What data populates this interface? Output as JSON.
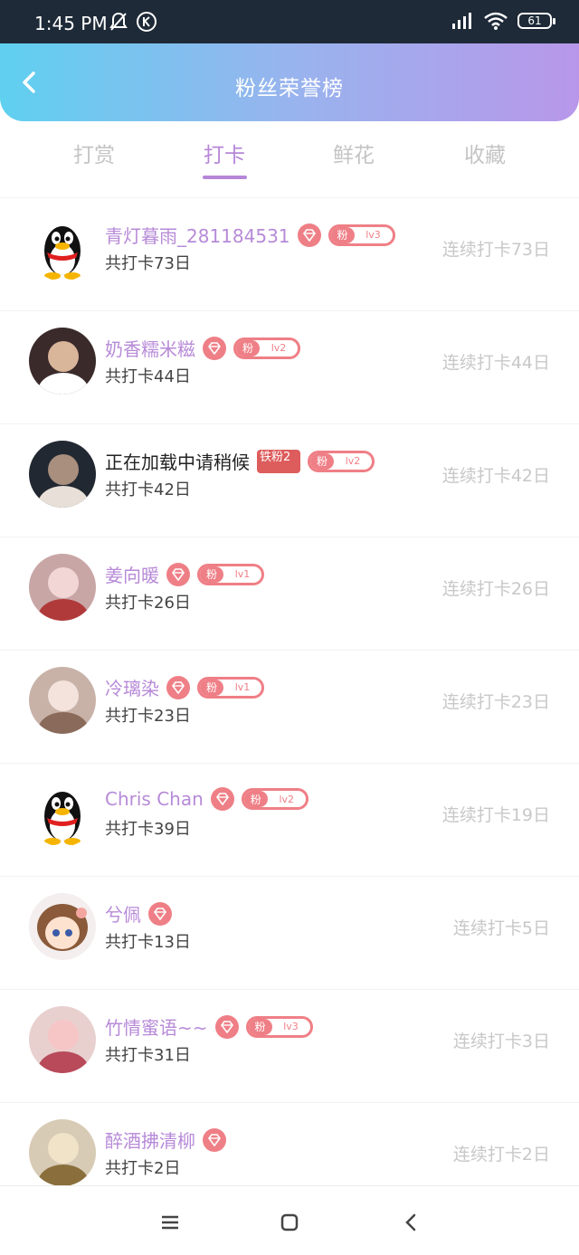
{
  "status": {
    "time": "1:45 PM",
    "battery": "61"
  },
  "header": {
    "title": "粉丝荣誉榜"
  },
  "tabs": [
    "打赏",
    "打卡",
    "鲜花",
    "收藏"
  ],
  "active_tab": 1,
  "rows": [
    {
      "name": "青灯暮雨_281184531",
      "total": "共打卡73日",
      "streak": "连续打卡73日",
      "level": "lv3",
      "fan": "粉",
      "avatar": "penguin-icon"
    },
    {
      "name": "奶香糯米糍",
      "total": "共打卡44日",
      "streak": "连续打卡44日",
      "level": "lv2",
      "fan": "粉",
      "avatar": "user-photo"
    },
    {
      "name": "正在加载中请稍候",
      "total": "共打卡42日",
      "streak": "连续打卡42日",
      "level": "lv2",
      "fan": "粉",
      "iron": "铁粉2",
      "avatar": "user-photo"
    },
    {
      "name": "姜向暖",
      "total": "共打卡26日",
      "streak": "连续打卡26日",
      "level": "lv1",
      "fan": "粉",
      "avatar": "user-photo"
    },
    {
      "name": "冷璃染",
      "total": "共打卡23日",
      "streak": "连续打卡23日",
      "level": "lv1",
      "fan": "粉",
      "avatar": "user-photo"
    },
    {
      "name": "Chris Chan",
      "total": "共打卡39日",
      "streak": "连续打卡19日",
      "level": "lv2",
      "fan": "粉",
      "avatar": "penguin-icon"
    },
    {
      "name": "兮佩",
      "total": "共打卡13日",
      "streak": "连续打卡5日",
      "avatar": "anime-avatar"
    },
    {
      "name": "竹情蜜语~~",
      "total": "共打卡31日",
      "streak": "连续打卡3日",
      "level": "lv3",
      "fan": "粉",
      "avatar": "user-photo"
    },
    {
      "name": "醉酒拂清柳",
      "total": "共打卡2日",
      "streak": "连续打卡2日",
      "avatar": "user-photo"
    }
  ]
}
